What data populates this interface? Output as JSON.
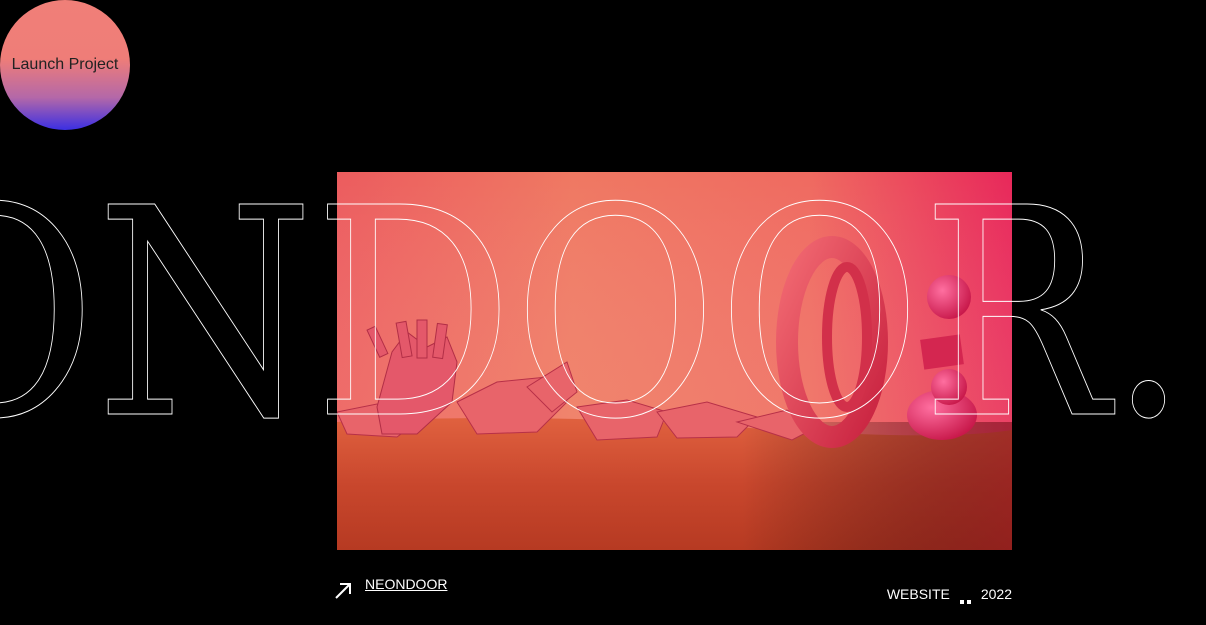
{
  "launch": {
    "label": "Launch Project"
  },
  "hero": {
    "word": "ONDOOR.",
    "colors": {
      "bg_top": "#ef6a63",
      "bg_right": "#e82a5c",
      "sand": "#c9472f",
      "sculpture": "#e84560"
    }
  },
  "project": {
    "name": "NEONDOOR",
    "type": "WEBSITE",
    "year": "2022"
  },
  "icons": {
    "arrow": "arrow-up-right-icon"
  }
}
